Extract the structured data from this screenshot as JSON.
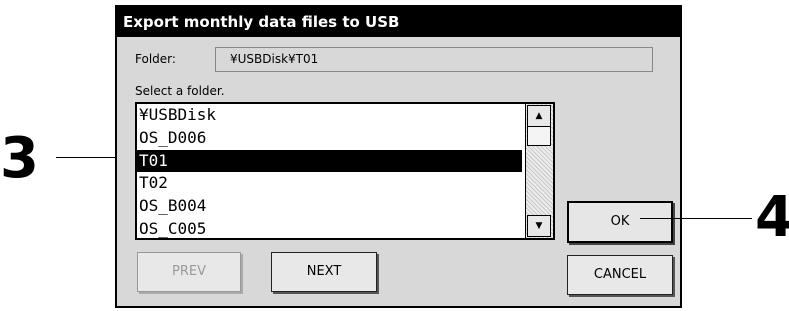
{
  "dialog": {
    "title": "Export monthly data files to USB",
    "folder_label": "Folder:",
    "folder_value": "¥USBDisk¥T01",
    "instruction": "Select a folder.",
    "list_items": [
      "¥USBDisk",
      "OS_D006",
      "T01",
      "T02",
      "OS_B004",
      "OS_C005"
    ],
    "selected_item": "T01",
    "buttons": {
      "prev": "PREV",
      "next": "NEXT",
      "ok": "OK",
      "cancel": "CANCEL"
    }
  },
  "callouts": {
    "left_number": "3",
    "right_number": "4"
  },
  "icons": {
    "scroll_up": "arrow-up-icon",
    "scroll_down": "arrow-down-icon"
  }
}
